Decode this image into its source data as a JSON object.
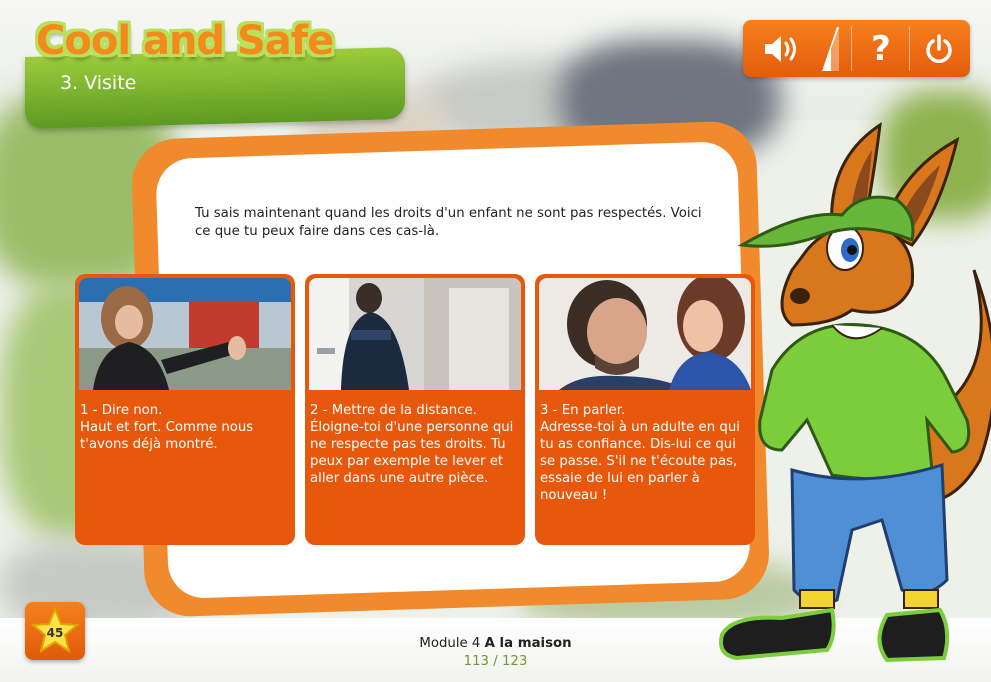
{
  "app": {
    "title": "Cool and Safe"
  },
  "section": {
    "label": "3. Visite"
  },
  "toolbar": {
    "icons": [
      "speaker-icon",
      "volume-level-icon",
      "help-icon",
      "power-icon"
    ],
    "help_glyph": "?"
  },
  "main": {
    "intro": "Tu sais maintenant quand les droits d'un enfant ne sont pas respectés. Voici ce que tu peux faire dans ces cas-là.",
    "cards": [
      {
        "title": "1 - Dire non.",
        "body": "Haut et fort. Comme nous t'avons déjà montré."
      },
      {
        "title": "2 - Mettre de la distance.",
        "body": "Éloigne-toi d'une personne qui ne respecte pas tes droits. Tu peux par exemple te lever et aller dans une autre pièce."
      },
      {
        "title": "3 - En parler.",
        "body": "Adresse-toi à un adulte en qui tu as confiance. Dis-lui ce qui se passe. S'il ne t'écoute pas, essaie de lui en parler à nouveau !"
      }
    ]
  },
  "footer": {
    "star_count": "45",
    "module_prefix": "Module 4",
    "module_name": "A la maison",
    "page_counter": "113 / 123"
  },
  "colors": {
    "accent_orange": "#e8580c",
    "accent_green": "#6fa82a"
  }
}
